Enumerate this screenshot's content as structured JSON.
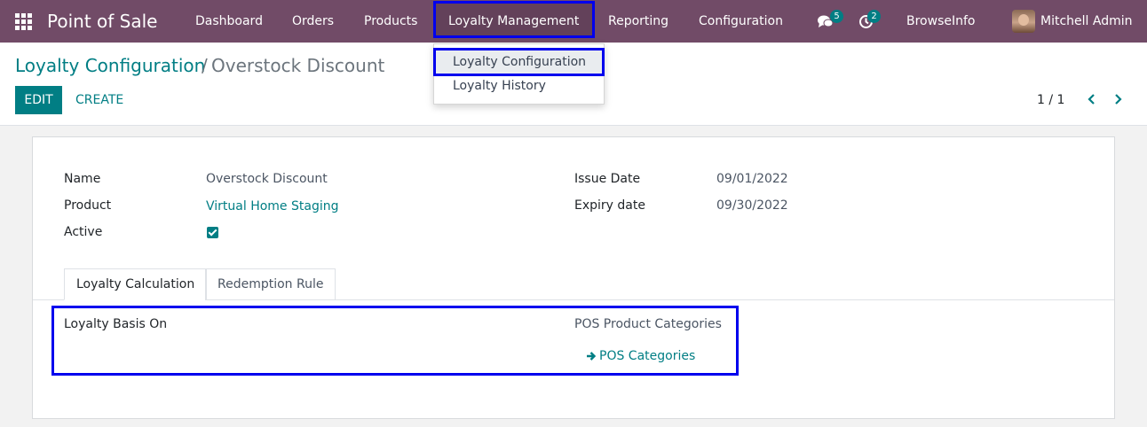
{
  "navbar": {
    "app_title": "Point of Sale",
    "menu": [
      "Dashboard",
      "Orders",
      "Products",
      "Loyalty Management",
      "Reporting",
      "Configuration"
    ],
    "messages_count": "5",
    "activities_count": "2",
    "company": "BrowseInfo",
    "user": "Mitchell Admin"
  },
  "dropdown": {
    "items": [
      "Loyalty Configuration",
      "Loyalty History"
    ]
  },
  "breadcrumb": {
    "parent": "Loyalty Configuration",
    "separator": "/",
    "current": "Overstock Discount"
  },
  "buttons": {
    "edit": "EDIT",
    "create": "CREATE"
  },
  "pager": {
    "value": "1 / 1"
  },
  "form": {
    "name_label": "Name",
    "name_value": "Overstock Discount",
    "product_label": "Product",
    "product_value": "Virtual Home Staging",
    "active_label": "Active",
    "active_value": true,
    "issue_date_label": "Issue Date",
    "issue_date_value": "09/01/2022",
    "expiry_date_label": "Expiry date",
    "expiry_date_value": "09/30/2022"
  },
  "tabs": [
    "Loyalty Calculation",
    "Redemption Rule"
  ],
  "loyalty_calc": {
    "basis_label": "Loyalty Basis On",
    "basis_value": "POS Product Categories",
    "categories_link": "POS Categories"
  },
  "colors": {
    "navbar": "#714b67",
    "accent": "#017e84",
    "highlight": "#0000ee"
  }
}
